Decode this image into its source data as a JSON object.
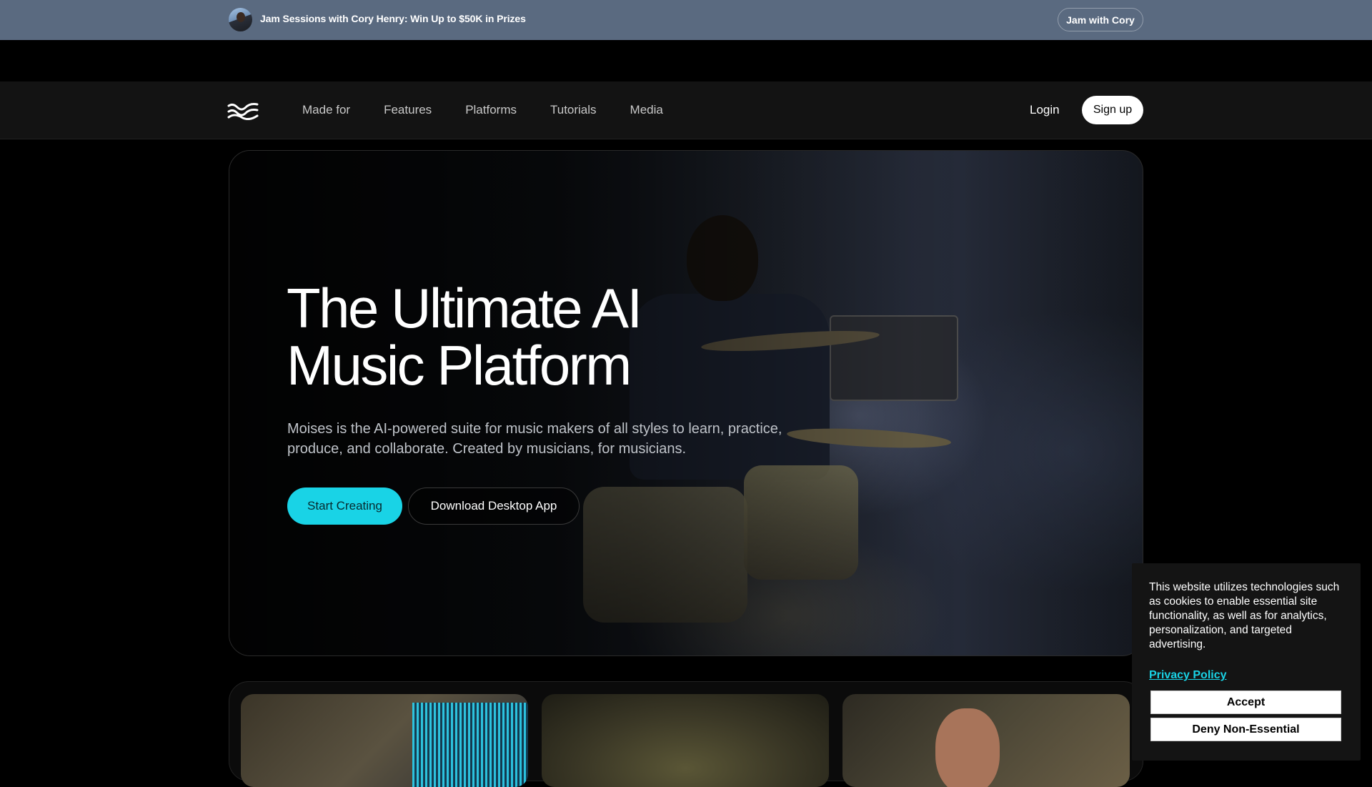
{
  "announcement": {
    "text": "Jam Sessions with Cory Henry: Win Up to $50K in Prizes",
    "button_label": "Jam with Cory"
  },
  "nav": {
    "links": [
      "Made for",
      "Features",
      "Platforms",
      "Tutorials",
      "Media"
    ],
    "login_label": "Login",
    "signup_label": "Sign up"
  },
  "hero": {
    "title_line1": "The Ultimate AI",
    "title_line2": "Music Platform",
    "subtitle": "Moises is the AI-powered suite for music makers of all styles to learn, practice, produce, and collaborate. Created by musicians, for musicians.",
    "primary_cta": "Start Creating",
    "secondary_cta": "Download Desktop App"
  },
  "cookie": {
    "message": "This website utilizes technologies such as cookies to enable essential site functionality, as well as for analytics, personalization, and targeted advertising.",
    "policy_link": "Privacy Policy",
    "accept_label": "Accept",
    "deny_label": "Deny Non-Essential"
  },
  "colors": {
    "accent": "#19d3e6",
    "announcement_bg": "#5a6a80",
    "nav_bg": "#131313"
  }
}
